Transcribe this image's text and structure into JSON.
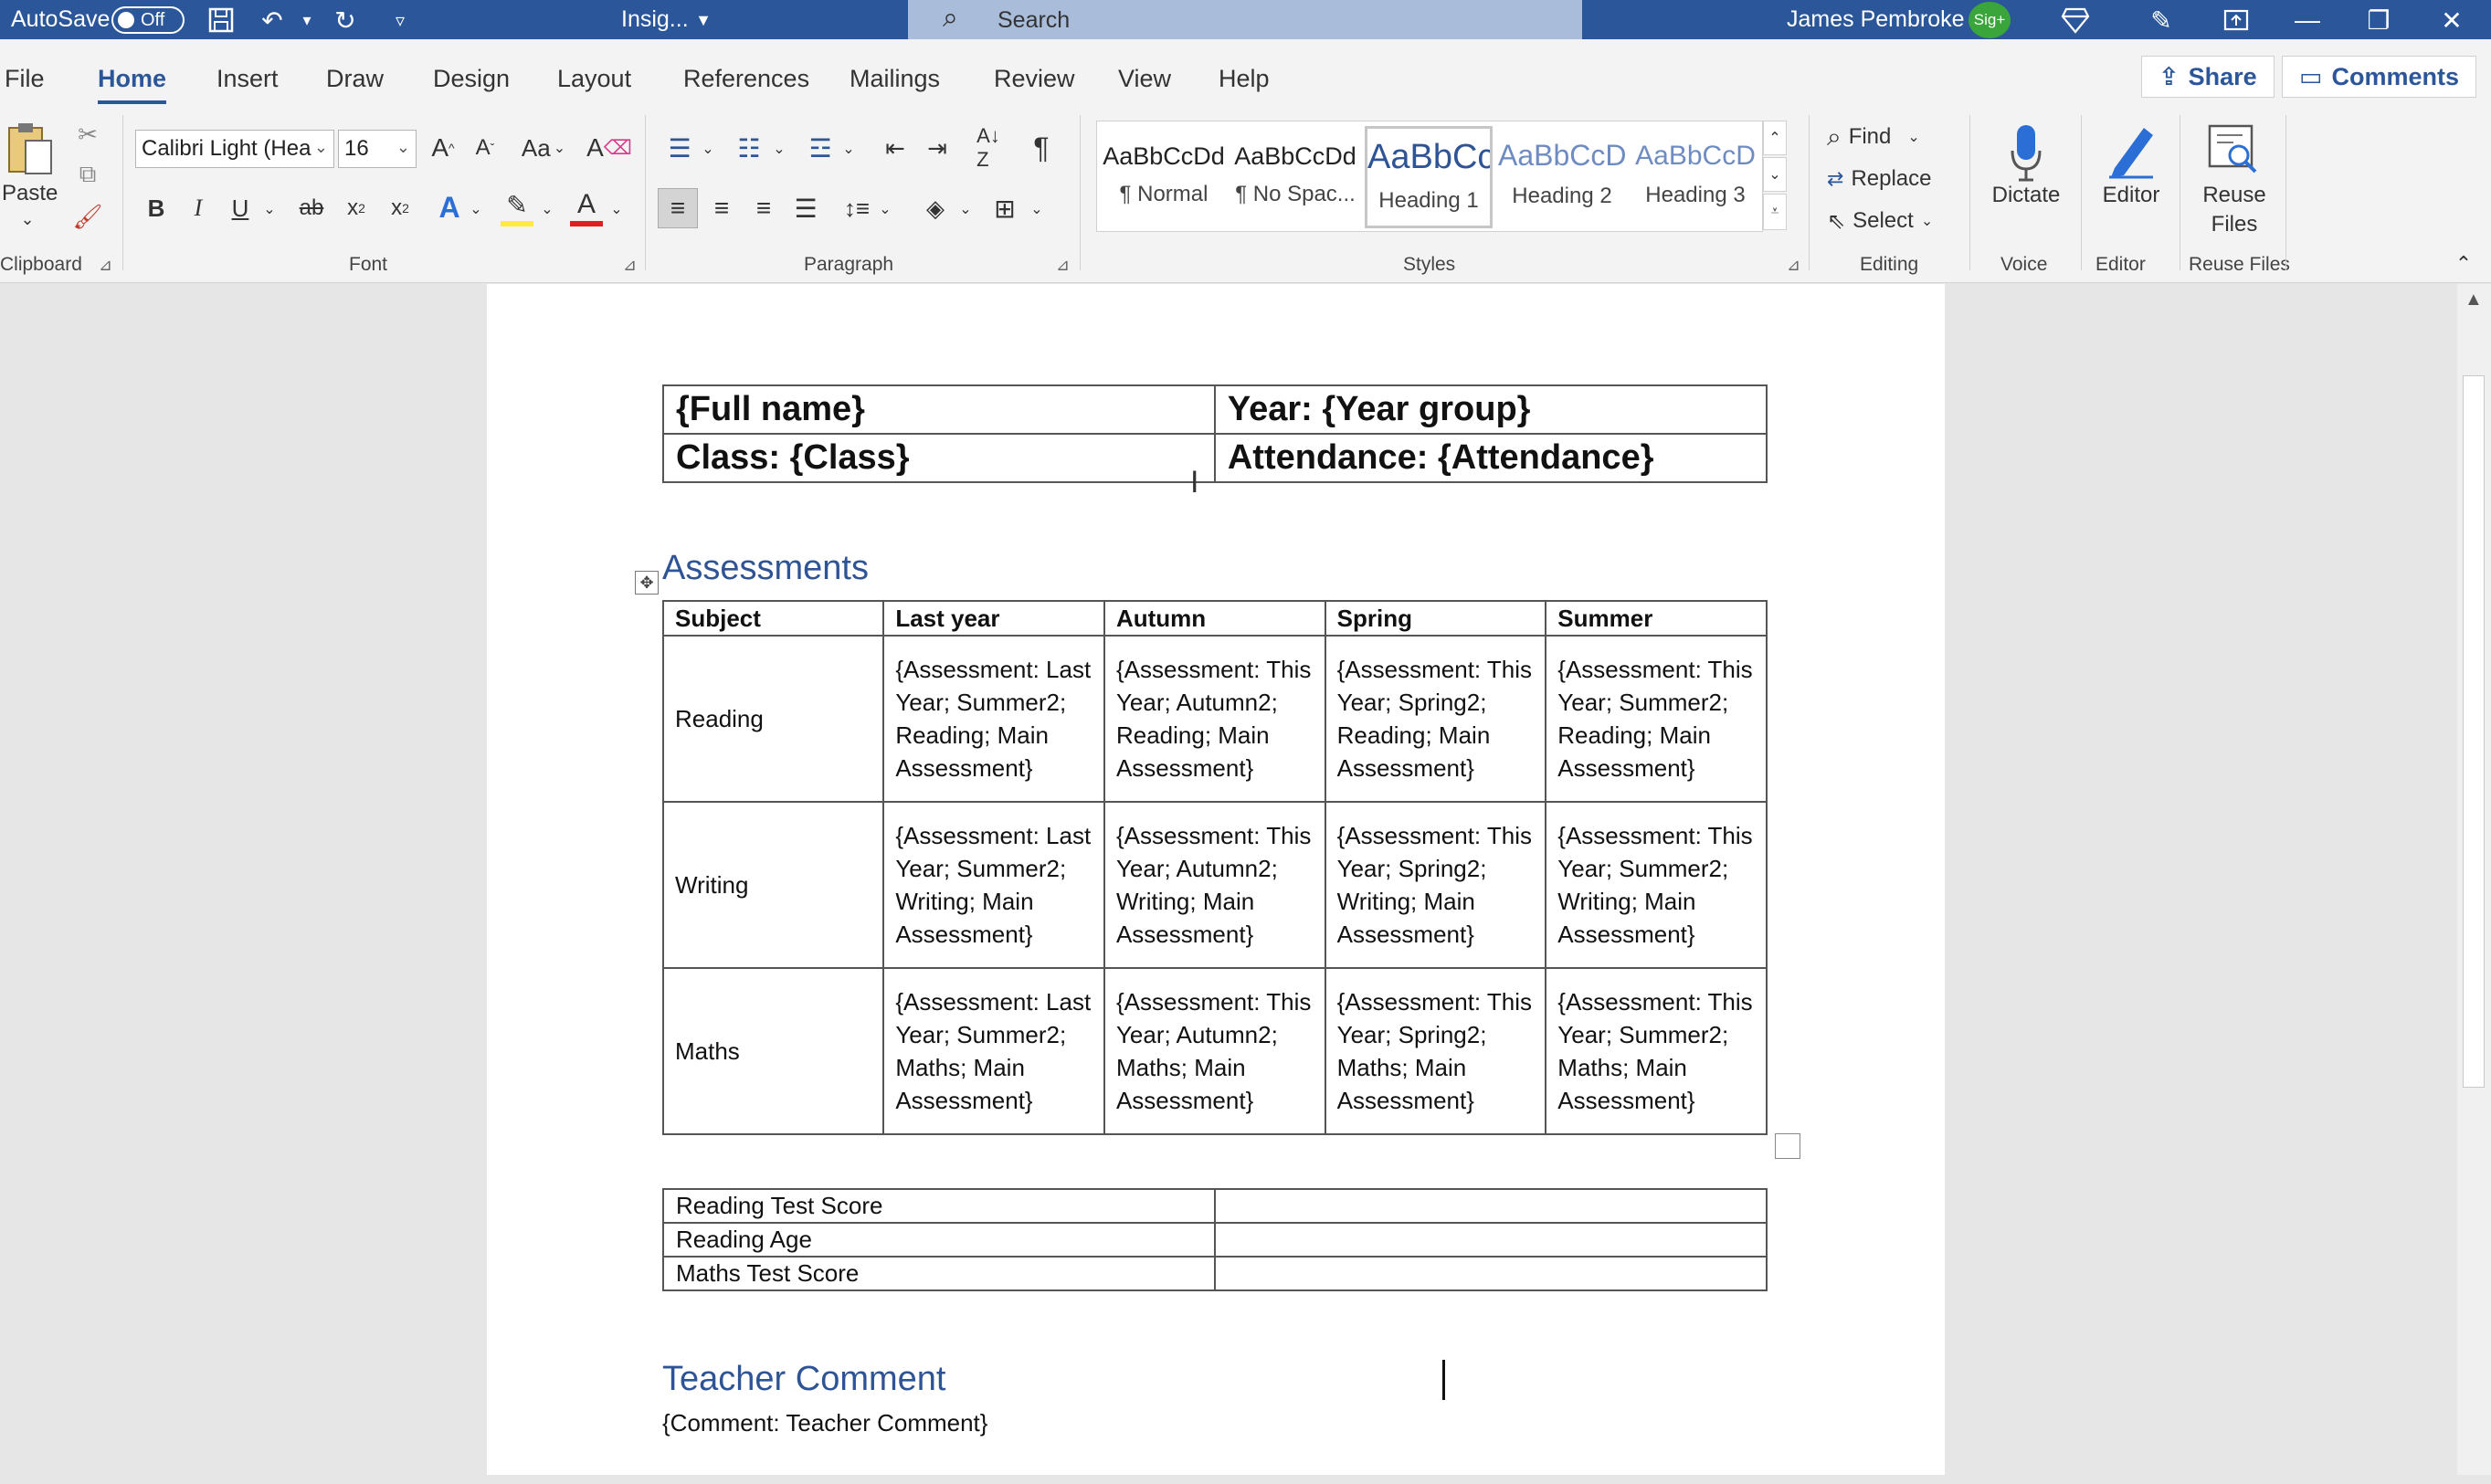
{
  "titlebar": {
    "autosave_label": "AutoSave",
    "autosave_state": "Off",
    "doc_name": "Insig...",
    "search_placeholder": "Search",
    "user_name": "James Pembroke",
    "user_initials": "Sig+"
  },
  "menu": {
    "tabs": [
      "File",
      "Home",
      "Insert",
      "Draw",
      "Design",
      "Layout",
      "References",
      "Mailings",
      "Review",
      "View",
      "Help"
    ],
    "active_tab": "Home",
    "share_label": "Share",
    "comments_label": "Comments"
  },
  "ribbon": {
    "clipboard": {
      "paste_label": "Paste",
      "group_label": "Clipboard"
    },
    "font": {
      "name": "Calibri Light (Hea",
      "size": "16",
      "case_label": "Aa",
      "group_label": "Font"
    },
    "paragraph": {
      "group_label": "Paragraph"
    },
    "styles": {
      "items": [
        {
          "preview": "AaBbCcDd",
          "name": "¶ Normal"
        },
        {
          "preview": "AaBbCcDd",
          "name": "¶ No Spac..."
        },
        {
          "preview": "AaBbCc",
          "name": "Heading 1"
        },
        {
          "preview": "AaBbCcD",
          "name": "Heading 2"
        },
        {
          "preview": "AaBbCcD",
          "name": "Heading 3"
        }
      ],
      "group_label": "Styles"
    },
    "editing": {
      "find_label": "Find",
      "replace_label": "Replace",
      "select_label": "Select",
      "group_label": "Editing"
    },
    "voice": {
      "dictate_label": "Dictate",
      "group_label": "Voice"
    },
    "editor": {
      "editor_label": "Editor",
      "group_label": "Editor"
    },
    "reuse": {
      "label_line1": "Reuse",
      "label_line2": "Files",
      "group_label": "Reuse Files"
    }
  },
  "document": {
    "info_table": [
      [
        "{Full name}",
        "Year: {Year group}"
      ],
      [
        "Class: {Class}",
        "Attendance: {Attendance}"
      ]
    ],
    "assessments_heading": "Assessments",
    "assessments_header": [
      "Subject",
      "Last year",
      "Autumn",
      "Spring",
      "Summer"
    ],
    "assessments_rows": [
      [
        "Reading",
        "{Assessment: Last Year; Summer2; Reading; Main Assessment}",
        "{Assessment: This Year; Autumn2; Reading; Main Assessment}",
        "{Assessment: This Year; Spring2; Reading; Main Assessment}",
        "{Assessment: This Year; Summer2; Reading; Main Assessment}"
      ],
      [
        "Writing",
        "{Assessment: Last Year; Summer2; Writing; Main Assessment}",
        "{Assessment: This Year; Autumn2; Writing; Main Assessment}",
        "{Assessment: This Year; Spring2; Writing; Main Assessment}",
        "{Assessment: This Year; Summer2; Writing; Main Assessment}"
      ],
      [
        "Maths",
        "{Assessment: Last Year; Summer2; Maths; Main Assessment}",
        "{Assessment: This Year; Autumn2; Maths; Main Assessment}",
        "{Assessment: This Year; Spring2; Maths; Main Assessment}",
        "{Assessment: This Year; Summer2; Maths; Main Assessment}"
      ]
    ],
    "score_table": [
      [
        "Reading Test Score",
        ""
      ],
      [
        "Reading Age",
        ""
      ],
      [
        "Maths Test Score",
        ""
      ]
    ],
    "teacher_heading": "Teacher Comment",
    "teacher_comment": "{Comment: Teacher Comment}"
  },
  "colors": {
    "accent": "#2b579a",
    "heading": "#2f5496"
  },
  "icons": [
    "save-icon",
    "undo-icon",
    "redo-icon",
    "search-icon",
    "diamond-icon",
    "pen-icon",
    "ribbon-display-icon",
    "minimize-icon",
    "restore-icon",
    "close-icon",
    "share-icon",
    "comment-icon",
    "microphone-icon"
  ]
}
